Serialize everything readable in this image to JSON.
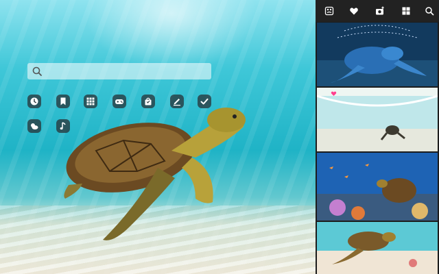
{
  "search": {
    "placeholder": "",
    "value": ""
  },
  "quick_links": [
    {
      "icon": "history-icon"
    },
    {
      "icon": "bookmark-icon"
    },
    {
      "icon": "apps-grid-icon"
    },
    {
      "icon": "gamepad-icon"
    },
    {
      "icon": "shopping-bag-icon"
    },
    {
      "icon": "edit-icon"
    },
    {
      "icon": "check-icon"
    },
    {
      "icon": "weather-icon"
    },
    {
      "icon": "music-icon"
    }
  ],
  "toolbar": {
    "items": [
      {
        "icon": "photo-icon"
      },
      {
        "icon": "heart-icon"
      },
      {
        "icon": "camera-add-icon"
      },
      {
        "icon": "grid-icon"
      },
      {
        "icon": "search-icon"
      }
    ]
  },
  "gallery": {
    "thumbnails": [
      {
        "subject": "blue-turtle-wallpaper"
      },
      {
        "subject": "turtle-shore-wallpaper",
        "liked": true
      },
      {
        "subject": "turtle-reef-wallpaper"
      },
      {
        "subject": "turtle-sand-wallpaper"
      }
    ]
  },
  "colors": {
    "sidebar_bg": "#1c1c1c",
    "tile_bg": "#28373c",
    "like_accent": "#ff3f8e"
  }
}
